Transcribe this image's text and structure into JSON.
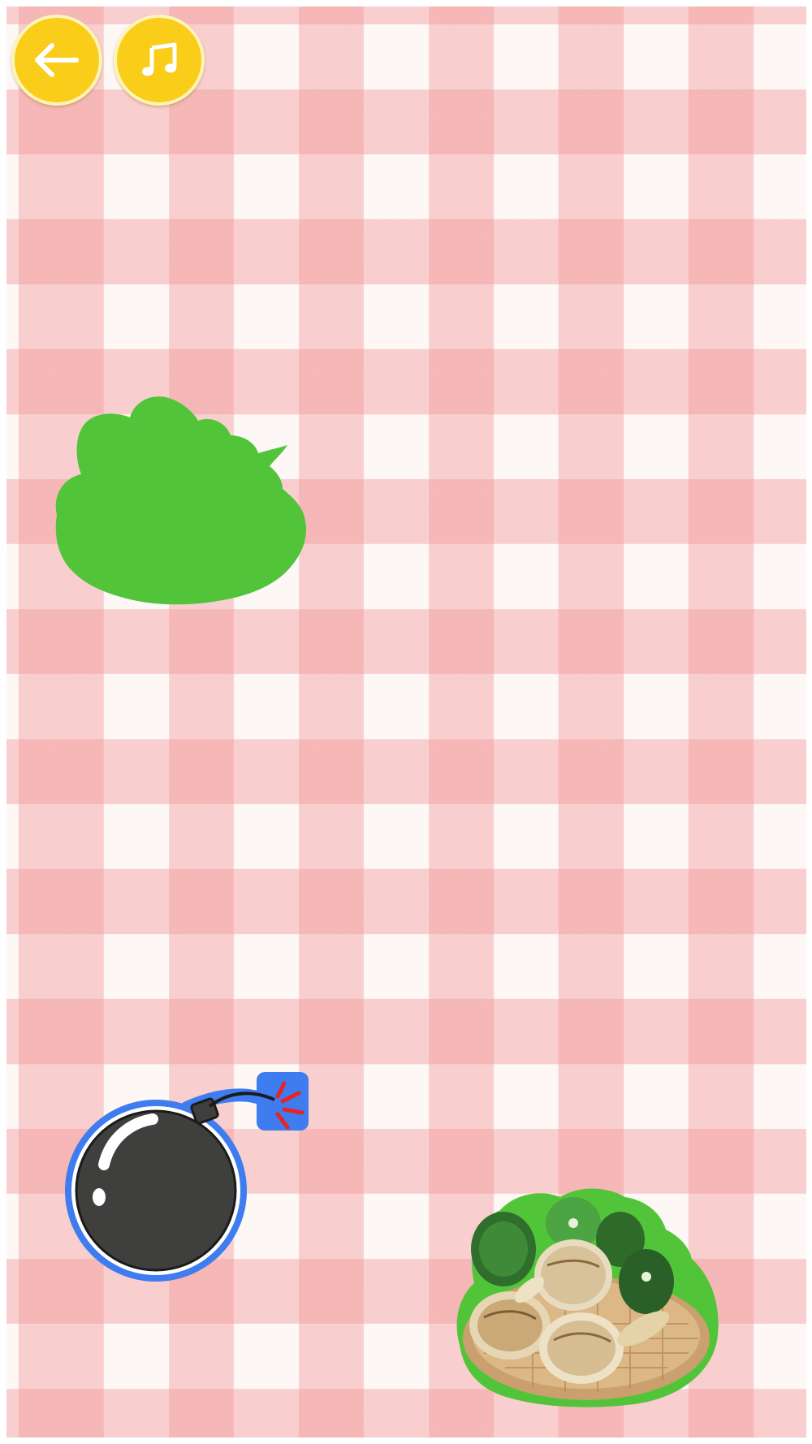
{
  "screen": {
    "background_pattern": "pink-gingham",
    "colors": {
      "button_fill": "#f9cd1a",
      "button_rim": "#fff4b8",
      "silhouette_green": "#52c43a",
      "bomb_outline": "#3e7cf0",
      "basket_outline": "#52c43a"
    }
  },
  "toolbar": {
    "back_button": {
      "icon": "arrow-left-icon"
    },
    "music_button": {
      "icon": "music-note-icon"
    }
  },
  "game": {
    "target_silhouette": {
      "shape": "basket-of-water-chestnuts-silhouette",
      "state": "unfilled"
    },
    "pieces": [
      {
        "name": "bomb",
        "icon": "bomb-icon",
        "outline": "blue"
      },
      {
        "name": "water-chestnut-basket",
        "icon": "water-chestnut-basket-icon",
        "outline": "green"
      }
    ]
  }
}
